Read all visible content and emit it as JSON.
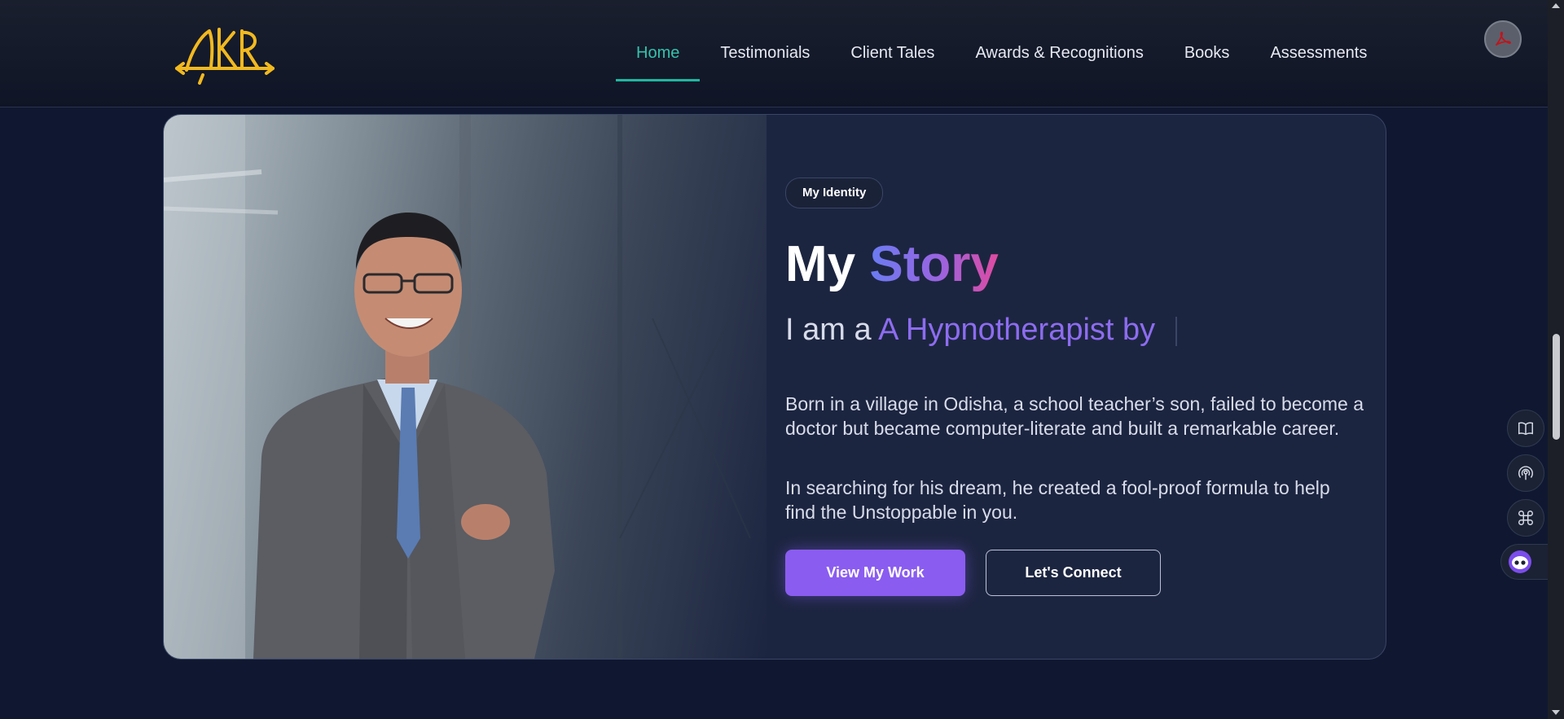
{
  "header": {
    "logo_text": "AKR",
    "nav": [
      {
        "label": "Home",
        "active": true
      },
      {
        "label": "Testimonials",
        "active": false
      },
      {
        "label": "Client Tales",
        "active": false
      },
      {
        "label": "Awards & Recognitions",
        "active": false
      },
      {
        "label": "Books",
        "active": false
      },
      {
        "label": "Assessments",
        "active": false
      }
    ],
    "pdf_icon": "acrobat-pdf-icon"
  },
  "hero": {
    "badge": "My Identity",
    "title_part1": "My",
    "title_part2": "Story",
    "iam_prefix": "I am a",
    "iam_typed": "A Hypnotherapist by",
    "paragraph1": "Born in a village in Odisha, a school teacher’s son, failed to become a doctor but became computer-literate and built a remarkable career.",
    "paragraph2": "In searching for his dream, he created a fool-proof formula to help find the Unstoppable in you.",
    "primary_button": "View My Work",
    "secondary_button": "Let's Connect"
  },
  "floating_tools": [
    "book-icon",
    "broadcast-icon",
    "command-icon",
    "chatbot-icon"
  ],
  "colors": {
    "background": "#0f1830",
    "card": "#1c2540",
    "accent_teal": "#1fb7a1",
    "accent_purple": "#8a5cf0",
    "logo_gold": "#f2b91f"
  }
}
